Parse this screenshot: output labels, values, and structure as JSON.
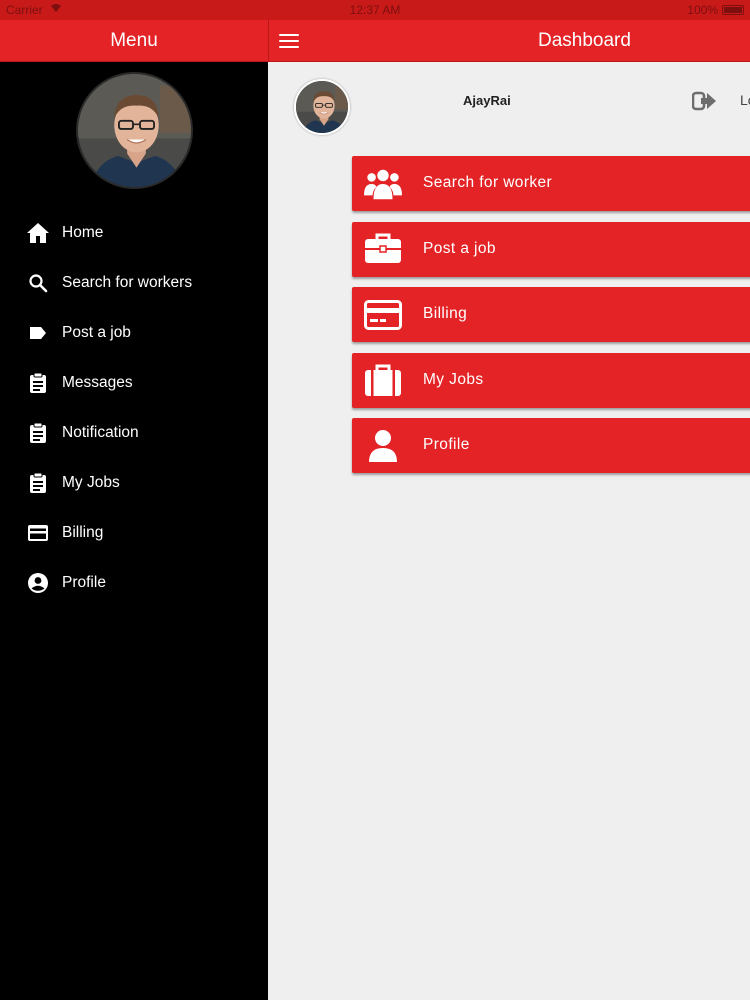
{
  "status_bar": {
    "carrier": "Carrier",
    "time": "12:37 AM",
    "battery": "100%"
  },
  "side_menu": {
    "title": "Menu",
    "items": [
      {
        "label": "Home",
        "icon": "home-icon"
      },
      {
        "label": "Search for workers",
        "icon": "search-icon"
      },
      {
        "label": "Post a job",
        "icon": "tag-icon"
      },
      {
        "label": "Messages",
        "icon": "clipboard-icon"
      },
      {
        "label": "Notification",
        "icon": "clipboard-icon"
      },
      {
        "label": "My Jobs",
        "icon": "clipboard-icon"
      },
      {
        "label": "Billing",
        "icon": "credit-card-icon"
      },
      {
        "label": "Profile",
        "icon": "account-circle-icon"
      }
    ]
  },
  "header": {
    "title": "Dashboard"
  },
  "user": {
    "name": "AjayRai",
    "logout_label": "Lo"
  },
  "dashboard": {
    "buttons": [
      {
        "label": "Search for worker",
        "icon": "users-group-icon"
      },
      {
        "label": "Post a job",
        "icon": "briefcase-icon"
      },
      {
        "label": "Billing",
        "icon": "credit-card-icon"
      },
      {
        "label": "My Jobs",
        "icon": "suitcase-icon"
      },
      {
        "label": "Profile",
        "icon": "user-icon"
      }
    ]
  },
  "colors": {
    "brand_red": "#e32326",
    "sidebar_bg": "#000000",
    "content_bg": "#efefef"
  }
}
